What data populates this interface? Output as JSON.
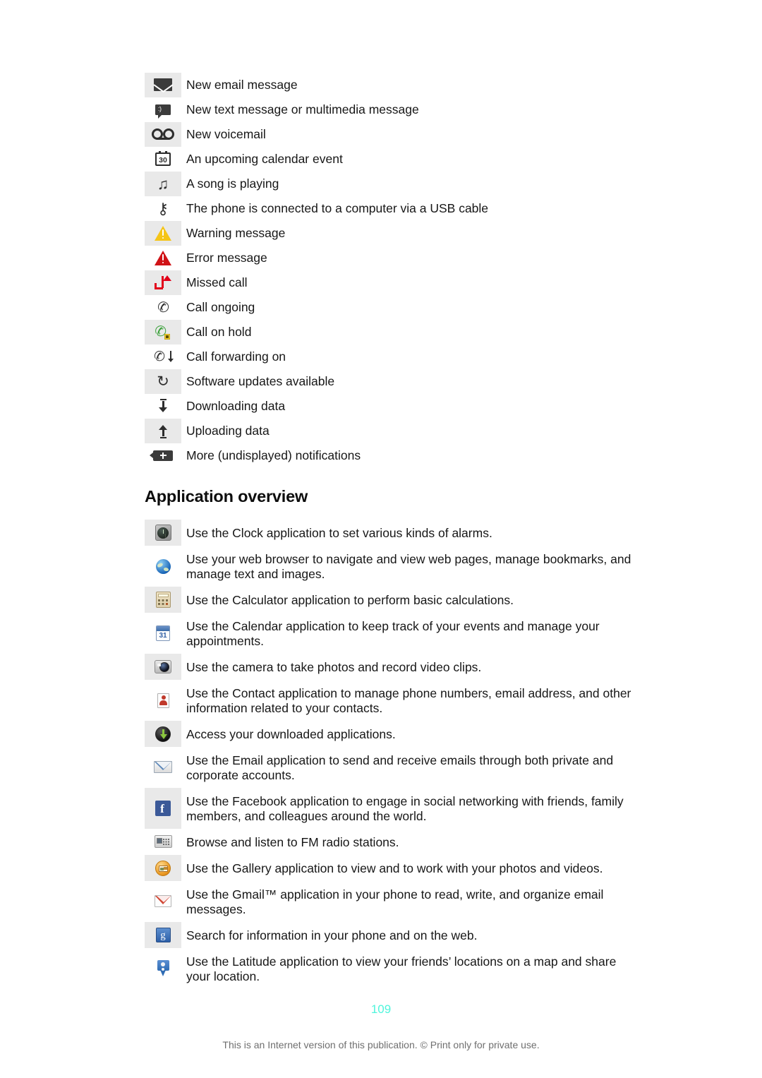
{
  "notifications": {
    "rows": [
      {
        "icon": "envelope-icon",
        "label": "New email message"
      },
      {
        "icon": "sms-message-icon",
        "label": "New text message or multimedia message"
      },
      {
        "icon": "voicemail-icon",
        "label": "New voicemail"
      },
      {
        "icon": "calendar-event-icon",
        "label": "An upcoming calendar event"
      },
      {
        "icon": "music-note-icon",
        "label": "A song is playing"
      },
      {
        "icon": "usb-icon",
        "label": "The phone is connected to a computer via a USB cable"
      },
      {
        "icon": "warning-triangle-icon",
        "label": "Warning message"
      },
      {
        "icon": "error-triangle-icon",
        "label": "Error message"
      },
      {
        "icon": "missed-call-icon",
        "label": "Missed call"
      },
      {
        "icon": "phone-handset-icon",
        "label": "Call ongoing"
      },
      {
        "icon": "call-on-hold-icon",
        "label": "Call on hold"
      },
      {
        "icon": "call-forwarding-icon",
        "label": "Call forwarding on"
      },
      {
        "icon": "sync-update-icon",
        "label": "Software updates available"
      },
      {
        "icon": "download-arrow-icon",
        "label": "Downloading data"
      },
      {
        "icon": "upload-arrow-icon",
        "label": "Uploading data"
      },
      {
        "icon": "more-notifications-icon",
        "label": "More (undisplayed) notifications"
      }
    ]
  },
  "app_overview": {
    "heading": "Application overview",
    "rows": [
      {
        "icon": "clock-app-icon",
        "label": "Use the Clock application to set various kinds of alarms."
      },
      {
        "icon": "browser-app-icon",
        "label": "Use your web browser to navigate and view web pages, manage bookmarks, and manage text and images."
      },
      {
        "icon": "calculator-app-icon",
        "label": "Use the Calculator application to perform basic calculations."
      },
      {
        "icon": "calendar-app-icon",
        "label": "Use the Calendar application to keep track of your events and manage your appointments."
      },
      {
        "icon": "camera-app-icon",
        "label": "Use the camera to take photos and record video clips."
      },
      {
        "icon": "contacts-app-icon",
        "label": "Use the Contact application to manage phone numbers, email address, and other information related to your contacts."
      },
      {
        "icon": "downloads-app-icon",
        "label": "Access your downloaded applications."
      },
      {
        "icon": "email-app-icon",
        "label": "Use the Email application to send and receive emails through both private and corporate accounts."
      },
      {
        "icon": "facebook-app-icon",
        "label": "Use the Facebook application to engage in social networking with friends, family members, and colleagues around the world."
      },
      {
        "icon": "fm-radio-app-icon",
        "label": "Browse and listen to FM radio stations."
      },
      {
        "icon": "gallery-app-icon",
        "label": "Use the Gallery application to view and to work with your photos and videos."
      },
      {
        "icon": "gmail-app-icon",
        "label": "Use the Gmail™ application in your phone to read, write, and organize email messages."
      },
      {
        "icon": "google-search-app-icon",
        "label": "Search for information in your phone and on the web."
      },
      {
        "icon": "latitude-app-icon",
        "label": "Use the Latitude application to view your friends’ locations on a map and share your location."
      }
    ]
  },
  "icon_glyphs": {
    "calendar_event_day": "30",
    "calendar_app_day": "31",
    "music_note": "♫",
    "usb": "⚷",
    "phone_handset": "✆",
    "sync": "↻",
    "facebook_letter": "f",
    "google_letter": "g"
  },
  "footer": {
    "page_number": "109",
    "note": "This is an Internet version of this publication. © Print only for private use."
  },
  "colors": {
    "row_shade": "#e9e9e9",
    "page_number": "#4ff5dc",
    "warning": "#f5c518",
    "error": "#d01317",
    "missed_call": "#e2001a",
    "call_hold": "#3aa03a",
    "facebook": "#3b5998",
    "gmail": "#d14836"
  }
}
